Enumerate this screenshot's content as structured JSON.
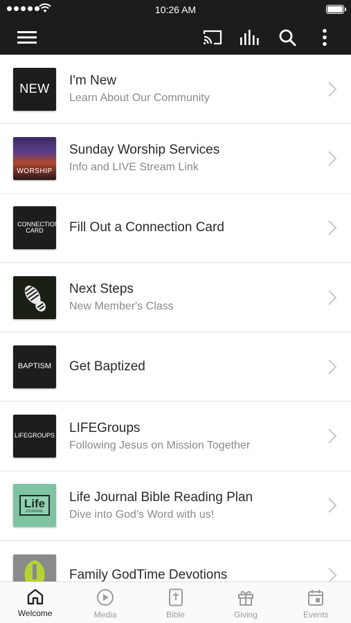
{
  "status_bar": {
    "time": "10:26 AM"
  },
  "app_bar": {
    "icons": [
      "menu-icon",
      "cast-icon",
      "audio-bars-icon",
      "search-icon",
      "more-vert-icon"
    ],
    "background": "#1c1c1e"
  },
  "list": {
    "items": [
      {
        "title": "I'm New",
        "subtitle": "Learn About Our Community",
        "thumb_text": "NEW",
        "thumb_bg": "#1d1d1d"
      },
      {
        "title": "Sunday Worship Services",
        "subtitle": "Info and LIVE Stream Link",
        "thumb_text": "WORSHIP",
        "thumb_bg": "#2a1a3a"
      },
      {
        "title": "Fill Out a Connection Card",
        "subtitle": "",
        "thumb_text": "CONNECTION CARD",
        "thumb_bg": "#1d1d1d"
      },
      {
        "title": "Next Steps",
        "subtitle": "New Member's Class",
        "thumb_text": "",
        "thumb_bg": "#1a1f16"
      },
      {
        "title": "Get Baptized",
        "subtitle": "",
        "thumb_text": "BAPTISM",
        "thumb_bg": "#1d1d1d"
      },
      {
        "title": "LIFEGroups",
        "subtitle": "Following Jesus on Mission Together",
        "thumb_text": "LIFEGROUPS",
        "thumb_bg": "#1d1d1d"
      },
      {
        "title": "Life Journal Bible Reading Plan",
        "subtitle": "Dive into God's Word with us!",
        "thumb_text": "Life",
        "thumb_subtext": "JOURNAL",
        "thumb_bg": "#7fc3a3"
      },
      {
        "title": "Family GodTime Devotions",
        "subtitle": "",
        "thumb_text": "",
        "thumb_bg": "#8a8a8a"
      }
    ]
  },
  "tab_bar": {
    "tabs": [
      {
        "label": "Welcome",
        "icon": "home-icon",
        "active": true
      },
      {
        "label": "Media",
        "icon": "play-circle-icon",
        "active": false
      },
      {
        "label": "Bible",
        "icon": "bible-icon",
        "active": false
      },
      {
        "label": "Giving",
        "icon": "gift-icon",
        "active": false
      },
      {
        "label": "Events",
        "icon": "calendar-icon",
        "active": false
      }
    ]
  },
  "colors": {
    "active_tab": "#222222",
    "inactive_tab": "#9b9b9b",
    "chevron": "#c7c7cc"
  }
}
